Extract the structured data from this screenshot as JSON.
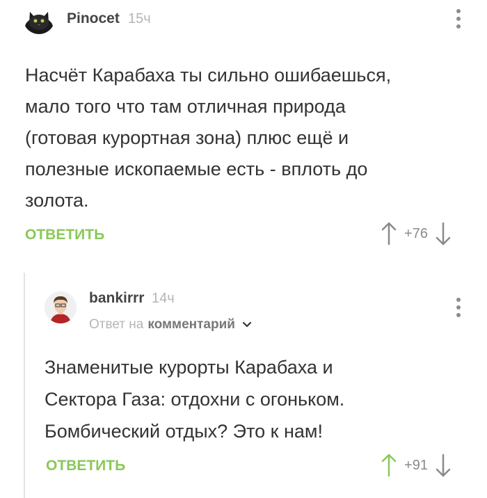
{
  "comments": [
    {
      "username": "Pinocet",
      "time": "15ч",
      "text_lines": [
        "Насчёт Карабаха ты сильно ошибаешься,",
        "мало того что там отличная природа",
        "(готовая курортная зона) плюс ещё и",
        "полезные ископаемые есть - вплоть до",
        "золота."
      ],
      "reply_label": "ОТВЕТИТЬ",
      "rating": "+76"
    },
    {
      "username": "bankirrr",
      "time": "14ч",
      "reply_to_prefix": "Ответ на",
      "reply_to_link": "комментарий",
      "text_lines": [
        "Знаменитые курорты Карабаха и",
        "Сектора Газа: отдохни с огоньком.",
        "Бомбический отдых? Это к нам!"
      ],
      "reply_label": "ОТВЕТИТЬ",
      "rating": "+91"
    }
  ],
  "icons": {
    "avatar1": "cat-avatar-icon",
    "avatar2": "man-avatar-icon",
    "menu": "more-vertical-icon",
    "upvote": "arrow-up-icon",
    "downvote": "arrow-down-icon",
    "expand": "chevron-down-icon"
  },
  "colors": {
    "accent": "#8ac858",
    "text": "#333333",
    "muted": "#b5b5b5"
  }
}
